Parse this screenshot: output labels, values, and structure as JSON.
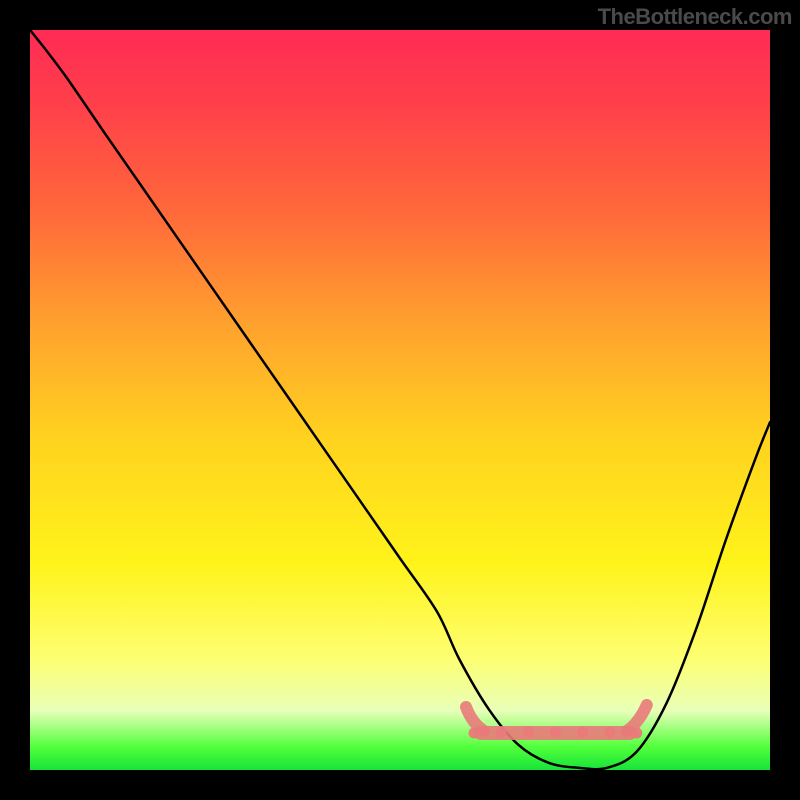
{
  "watermark": "TheBottleneck.com",
  "chart_data": {
    "type": "line",
    "title": "",
    "xlabel": "",
    "ylabel": "",
    "xlim": [
      0,
      1
    ],
    "ylim": [
      0,
      1
    ],
    "series": [
      {
        "name": "curve",
        "x": [
          0.0,
          0.02,
          0.05,
          0.1,
          0.15,
          0.2,
          0.25,
          0.3,
          0.35,
          0.4,
          0.45,
          0.5,
          0.55,
          0.58,
          0.62,
          0.66,
          0.7,
          0.74,
          0.78,
          0.82,
          0.86,
          0.9,
          0.94,
          0.98,
          1.0
        ],
        "y": [
          1.0,
          0.975,
          0.935,
          0.862,
          0.79,
          0.718,
          0.646,
          0.574,
          0.502,
          0.43,
          0.358,
          0.286,
          0.214,
          0.15,
          0.082,
          0.034,
          0.01,
          0.003,
          0.003,
          0.025,
          0.09,
          0.19,
          0.31,
          0.42,
          0.47
        ]
      }
    ],
    "flat_region": {
      "x_start": 0.6,
      "x_end": 0.82,
      "y": 0.05,
      "color": "#e97a7a"
    }
  }
}
